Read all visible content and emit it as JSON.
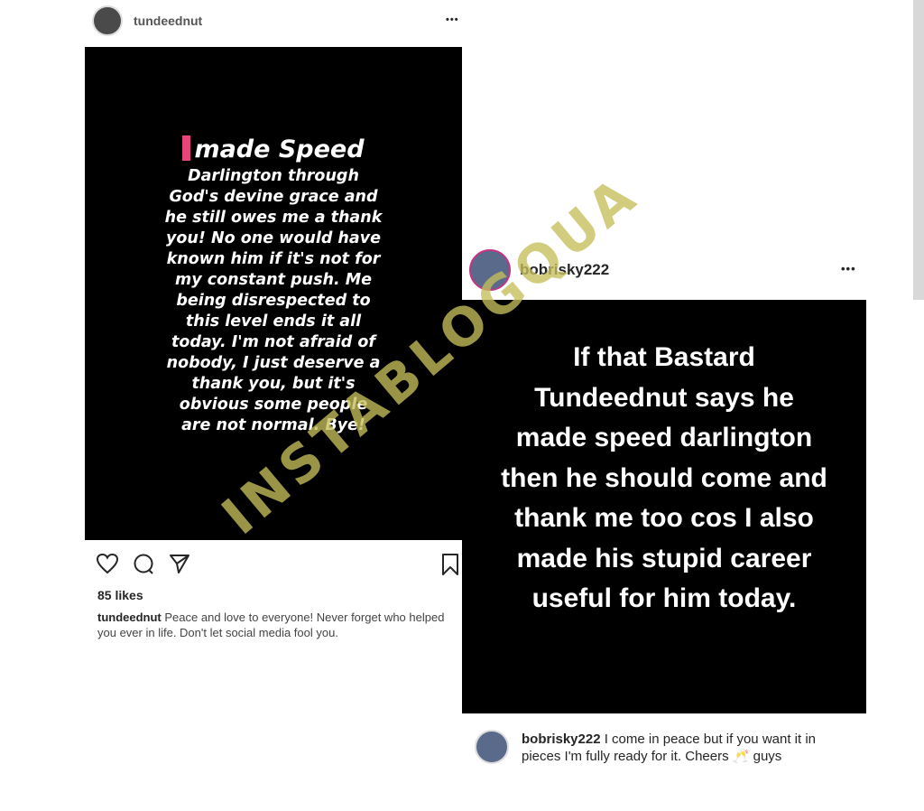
{
  "post1": {
    "username": "tundeednut",
    "story_first": "made Speed",
    "story_lines": [
      "Darlington through",
      "God's devine grace and",
      "he still owes me a thank",
      "you! No one would have",
      "known him if it's not for",
      "my constant push. Me",
      "being disrespected to",
      "this level ends it all",
      "today. I'm not afraid of",
      "nobody, I just deserve a",
      "thank you, but it's",
      "obvious some people",
      "are not normal. Bye!"
    ],
    "likes": "85 likes",
    "caption_user": "tundeednut",
    "caption_text": "Peace and love to everyone! Never forget who helped you ever in life. Don't let social media fool you."
  },
  "post2": {
    "username": "bobrisky222",
    "story_lines": [
      "If that Bastard",
      "Tundeednut says he",
      "made speed darlington",
      "then he should come and",
      "thank me too cos I also",
      "made his stupid career",
      "useful for him today."
    ],
    "caption_user": "bobrisky222",
    "caption_text": "I come in peace but if you want it in pieces I'm fully ready for it. Cheers 🥂 guys"
  },
  "watermark": "INSTABLOGQUA",
  "more_label": "•••"
}
